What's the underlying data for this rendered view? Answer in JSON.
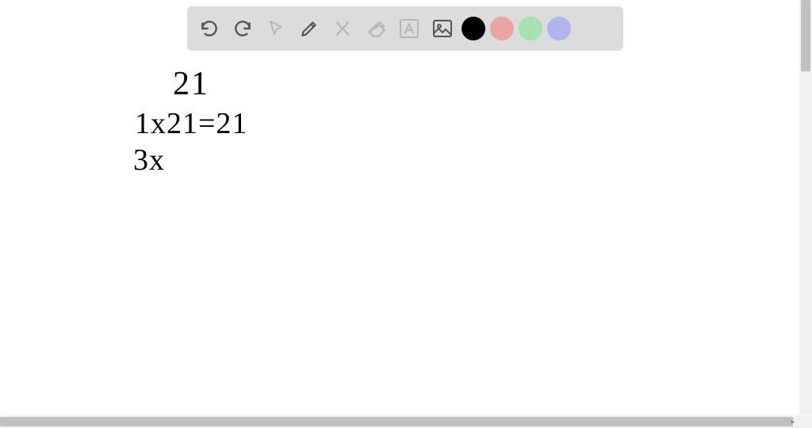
{
  "toolbar": {
    "undo_icon": "undo",
    "redo_icon": "redo",
    "pointer_icon": "pointer",
    "pen_icon": "pen",
    "tools_icon": "crossed-tools",
    "eraser_icon": "eraser",
    "text_icon": "text-A",
    "image_icon": "image",
    "colors": {
      "black": "#000000",
      "pink": "#e9a5a5",
      "green": "#a5e0b0",
      "purple": "#b0b5ec"
    }
  },
  "canvas": {
    "line1": "21",
    "line2": "1x21=21",
    "line3": "3x"
  }
}
